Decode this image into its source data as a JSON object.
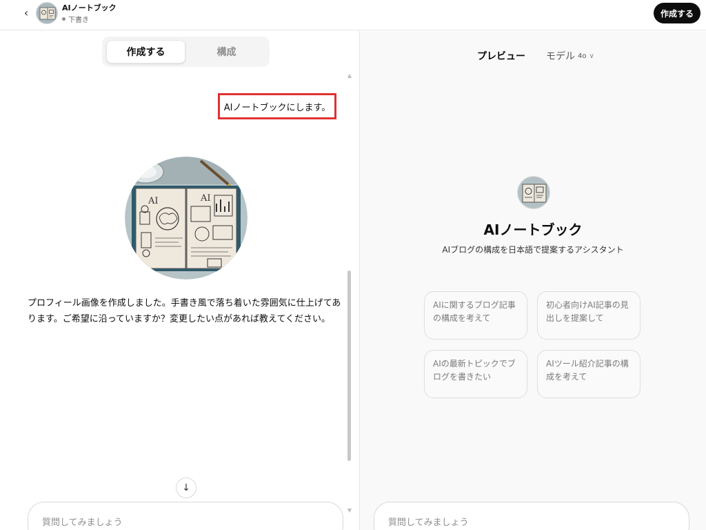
{
  "header": {
    "back_icon": "chevron-left-icon",
    "gpt_name": "AIノートブック",
    "status": "下書き",
    "create_button": "作成する"
  },
  "builder": {
    "tabs": [
      {
        "label": "作成する",
        "active": true
      },
      {
        "label": "構成",
        "active": false
      }
    ],
    "messages": {
      "user": "AIノートブックにします。",
      "assistant": "プロフィール画像を作成しました。手書き風で落ち着いた雰囲気に仕上げてあります。ご希望に沿っていますか？変更したい点があれば教えてください。"
    },
    "scroll_button_icon": "arrow-down-icon",
    "input_placeholder": "質問してみましょう"
  },
  "preview": {
    "label": "プレビュー",
    "model_label": "モデル",
    "model_version": "4o",
    "gpt_name": "AIノートブック",
    "description": "AIブログの構成を日本語で提案するアシスタント",
    "conversation_starters": [
      "AIに関するブログ記事の構成を考えて",
      "初心者向けAI記事の見出しを提案して",
      "AIの最新トピックでブログを書きたい",
      "AIツール紹介記事の構成を考えて"
    ],
    "input_placeholder": "質問してみましょう"
  },
  "colors": {
    "highlight_box": "#e03131",
    "button_dark": "#0d0d0d",
    "preview_background": "#f9f9f9"
  }
}
